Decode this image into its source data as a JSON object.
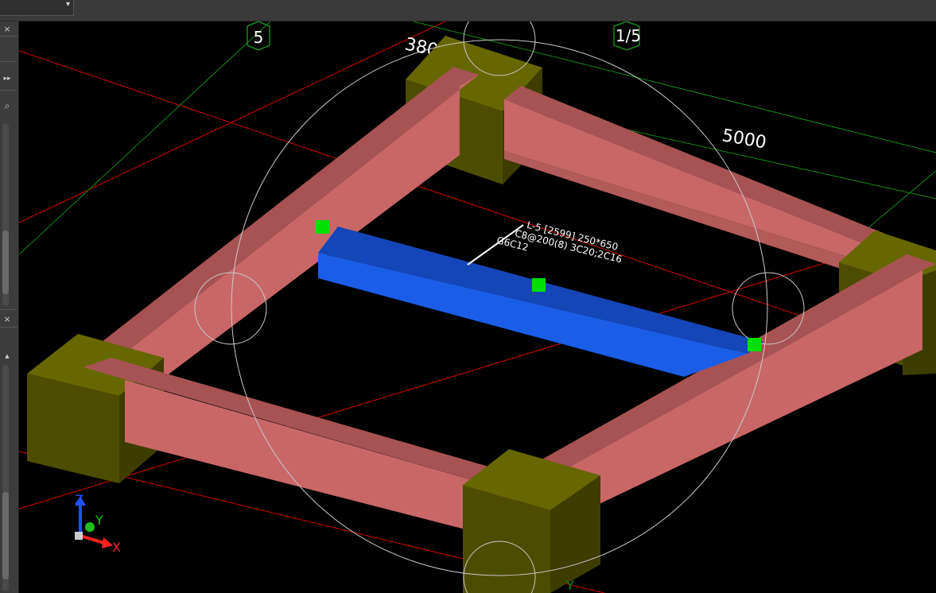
{
  "toolbar": {
    "view_select_value": "",
    "dropdown_arrow": "▾"
  },
  "side_panel": {
    "close_glyph": "×",
    "expand_glyph": "▸▸",
    "search_glyph": "⌕",
    "scroll_up_glyph": "▲"
  },
  "viewport": {
    "axis_bubbles": [
      "5",
      "1/5"
    ],
    "dimensions": [
      "380",
      "5000"
    ],
    "beam_label_lines": [
      "L-5 [2599] 250*650",
      "C8@200(8) 3C20;2C16",
      "G6C12"
    ],
    "ucs": {
      "x": "X",
      "y": "Y",
      "z": "Z",
      "y_bottom": "Y"
    }
  },
  "colors": {
    "background": "#000000",
    "beam_pink": "#c96767",
    "beam_pink_top": "#a85353",
    "column_olive": "#4d4d00",
    "column_olive_top": "#676700",
    "selected_beam": "#1a5ee8",
    "grip_green": "#00e000",
    "grid_red": "#d40000",
    "grid_green": "#138a13",
    "gizmo_white": "#c9c9c9"
  }
}
